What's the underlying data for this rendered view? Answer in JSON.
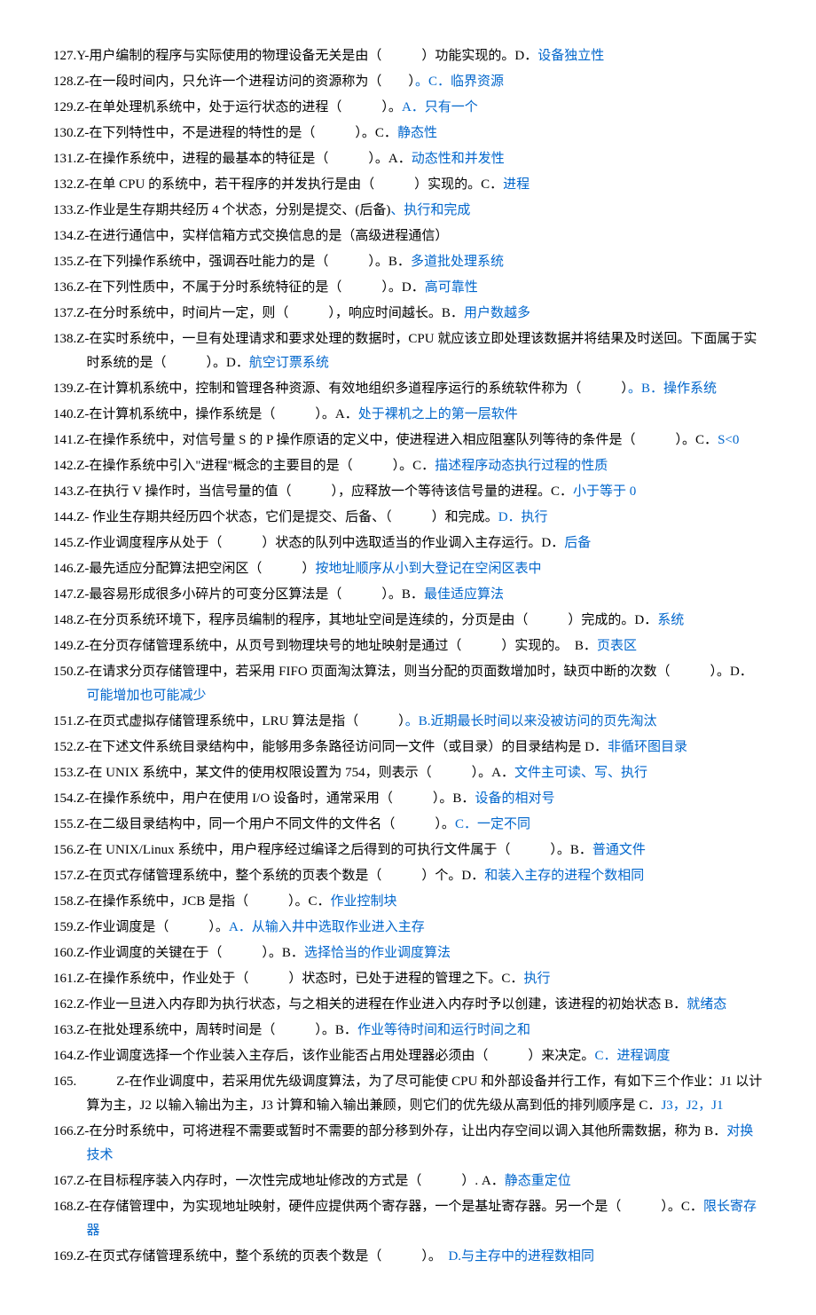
{
  "items": [
    {
      "num": "127",
      "prefix": "Y-",
      "text": "用户编制的程序与实际使用的物理设备无关是由（　　　）功能实现的。D．",
      "answer": "设备独立性"
    },
    {
      "num": "128",
      "prefix": "Z-",
      "text": "在一段时间内，只允许一个进程访问的资源称为（　　）",
      "answer": "。C．临界资源"
    },
    {
      "num": "129",
      "prefix": "Z-",
      "text": "在单处理机系统中，处于运行状态的进程（　　　）。",
      "answer": "A．只有一个"
    },
    {
      "num": "130",
      "prefix": "Z-",
      "text": "在下列特性中，不是进程的特性的是（　　　）。C．",
      "answer": "静态性"
    },
    {
      "num": "131",
      "prefix": "Z-",
      "text": "在操作系统中，进程的最基本的特征是（　　　）。A．",
      "answer": "动态性和并发性"
    },
    {
      "num": "132",
      "prefix": "Z-",
      "text": "在单 CPU 的系统中，若干程序的并发执行是由（　　　）实现的。C．",
      "answer": "进程"
    },
    {
      "num": "133",
      "prefix": "Z-",
      "text": "作业是生存期共经历 4 个状态，分别是提交、(后备)",
      "answer": "、执行和完成"
    },
    {
      "num": "134",
      "prefix": "Z-",
      "text": "在进行通信中，实样信箱方式交换信息的是（高级进程通信）",
      "answer": ""
    },
    {
      "num": "135",
      "prefix": "Z-",
      "text": "在下列操作系统中，强调吞吐能力的是（　　　）。B．",
      "answer": "多道批处理系统"
    },
    {
      "num": "136",
      "prefix": "Z-",
      "text": "在下列性质中，不属于分时系统特征的是（　　　）。D．",
      "answer": "高可靠性"
    },
    {
      "num": "137",
      "prefix": "Z-",
      "text": "在分时系统中，时间片一定，则（　　　），响应时间越长。B．",
      "answer": "用户数越多"
    },
    {
      "num": "138",
      "prefix": "Z-",
      "text": "在实时系统中，一旦有处理请求和要求处理的数据时，CPU 就应该立即处理该数据并将结果及时送回。下面属于实时系统的是（　　　）。D．",
      "answer": "航空订票系统"
    },
    {
      "num": "139",
      "prefix": "Z-",
      "text": "在计算机系统中，控制和管理各种资源、有效地组织多道程序运行的系统软件称为（　　　）",
      "answer": "。B．操作系统"
    },
    {
      "num": "140",
      "prefix": "Z-",
      "text": "在计算机系统中，操作系统是（　　　）。A．",
      "answer": "处于裸机之上的第一层软件"
    },
    {
      "num": "141",
      "prefix": "Z-",
      "text": "在操作系统中，对信号量 S 的 P 操作原语的定义中，使进程进入相应阻塞队列等待的条件是（　　　）。C．",
      "answer": "S<0"
    },
    {
      "num": "142",
      "prefix": "Z-",
      "text": "在操作系统中引入\"进程\"概念的主要目的是（　　　）。C．",
      "answer": "描述程序动态执行过程的性质"
    },
    {
      "num": "143",
      "prefix": "Z-",
      "text": "在执行 V 操作时，当信号量的值（　　　），应释放一个等待该信号量的进程。C．",
      "answer": "小于等于 0"
    },
    {
      "num": "144",
      "prefix": "Z-",
      "text": " 作业生存期共经历四个状态，它们是提交、后备、（　　　）和完成。",
      "answer": "D．执行"
    },
    {
      "num": "145",
      "prefix": "Z-",
      "text": "作业调度程序从处于（　　　）状态的队列中选取适当的作业调入主存运行。D．",
      "answer": "后备"
    },
    {
      "num": "146",
      "prefix": "Z-",
      "text": "最先适应分配算法把空闲区（　　　）",
      "answer": "按地址顺序从小到大登记在空闲区表中"
    },
    {
      "num": "147",
      "prefix": "Z-",
      "text": "最容易形成很多小碎片的可变分区算法是（　　　）。B．",
      "answer": "最佳适应算法"
    },
    {
      "num": "148",
      "prefix": "Z-",
      "text": "在分页系统环境下，程序员编制的程序，其地址空间是连续的，分页是由（　　　）完成的。D．",
      "answer": "系统"
    },
    {
      "num": "149",
      "prefix": "Z-",
      "text": "在分页存储管理系统中，从页号到物理块号的地址映射是通过（　　　）实现的。　B．",
      "answer": "页表区"
    },
    {
      "num": "150",
      "prefix": "Z-",
      "text": "在请求分页存储管理中，若采用 FIFO 页面淘汰算法，则当分配的页面数增加时，缺页中断的次数（　　　）。D．",
      "answer": "可能增加也可能减少"
    },
    {
      "num": "151",
      "prefix": "Z-",
      "text": "在页式虚拟存储管理系统中，LRU 算法是指（　　　）",
      "answer": "。B.近期最长时间以来没被访问的页先淘汰"
    },
    {
      "num": "152",
      "prefix": "Z-",
      "text": "在下述文件系统目录结构中，能够用多条路径访问同一文件（或目录）的目录结构是 D．",
      "answer": "非循环图目录"
    },
    {
      "num": "153",
      "prefix": "Z-",
      "text": "在 UNIX 系统中，某文件的使用权限设置为 754，则表示（　　　）。A．",
      "answer": "文件主可读、写、执行"
    },
    {
      "num": "154",
      "prefix": "Z-",
      "text": "在操作系统中，用户在使用 I/O 设备时，通常采用（　　　）。B．",
      "answer": "设备的相对号"
    },
    {
      "num": "155",
      "prefix": "Z-",
      "text": "在二级目录结构中，同一个用户不同文件的文件名（　　　）。",
      "answer": "C．一定不同"
    },
    {
      "num": "156",
      "prefix": "Z-",
      "text": "在 UNIX/Linux 系统中，用户程序经过编译之后得到的可执行文件属于（　　　）。B．",
      "answer": "普通文件"
    },
    {
      "num": "157",
      "prefix": "Z-",
      "text": "在页式存储管理系统中，整个系统的页表个数是（　　　）个。D．",
      "answer": "和装入主存的进程个数相同"
    },
    {
      "num": "158",
      "prefix": "Z-",
      "text": "在操作系统中，JCB 是指（　　　）。C．",
      "answer": "作业控制块"
    },
    {
      "num": "159",
      "prefix": "Z-",
      "text": "作业调度是（　　　）。",
      "answer": "A．从输入井中选取作业进入主存"
    },
    {
      "num": "160",
      "prefix": "Z-",
      "text": "作业调度的关键在于（　　　）。B．",
      "answer": "选择恰当的作业调度算法"
    },
    {
      "num": "161",
      "prefix": "Z-",
      "text": "在操作系统中，作业处于（　　　）状态时，已处于进程的管理之下。C．",
      "answer": "执行"
    },
    {
      "num": "162",
      "prefix": "Z-",
      "text": "作业一旦进入内存即为执行状态，与之相关的进程在作业进入内存时予以创建，该进程的初始状态 B．",
      "answer": "就绪态"
    },
    {
      "num": "163",
      "prefix": "Z-",
      "text": "在批处理系统中，周转时间是（　　　）。B．",
      "answer": "作业等待时间和运行时间之和"
    },
    {
      "num": "164",
      "prefix": "Z-",
      "text": "作业调度选择一个作业装入主存后，该作业能否占用处理器必须由（　　　）来决定。",
      "answer": "C．进程调度"
    },
    {
      "num": "165",
      "prefix": "　　　Z-",
      "text": "在作业调度中，若采用优先级调度算法，为了尽可能使 CPU 和外部设备并行工作，有如下三个作业：J1 以计算为主，J2 以输入输出为主，J3 计算和输入输出兼顾，则它们的优先级从高到低的排列顺序是 C．",
      "answer": "J3，J2，J1"
    },
    {
      "num": "166",
      "prefix": "Z-",
      "text": "在分时系统中，可将进程不需要或暂时不需要的部分移到外存，让出内存空间以调入其他所需数据，称为 B．",
      "answer": "对换技术"
    },
    {
      "num": "167",
      "prefix": "Z-",
      "text": "在目标程序装入内存时，一次性完成地址修改的方式是（　　　）. A．",
      "answer": "静态重定位"
    },
    {
      "num": "168",
      "prefix": "Z-",
      "text": "在存储管理中，为实现地址映射，硬件应提供两个寄存器，一个是基址寄存器。另一个是（　　　）。C．",
      "answer": "限长寄存器"
    },
    {
      "num": "169",
      "prefix": "Z-",
      "text": "在页式存储管理系统中，整个系统的页表个数是（　　　）。　",
      "answer": "D.与主存中的进程数相同"
    }
  ]
}
